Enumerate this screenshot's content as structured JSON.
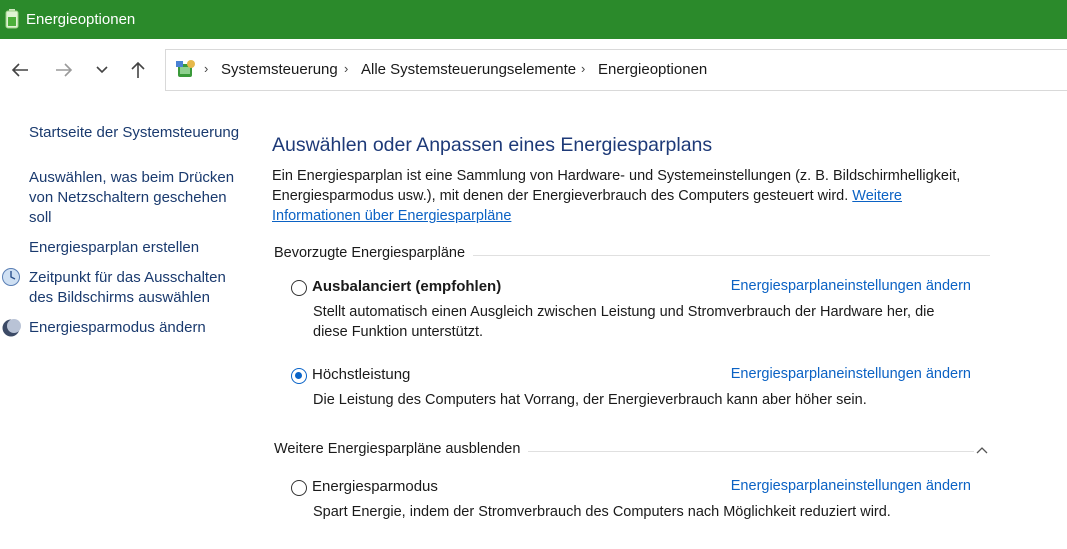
{
  "window": {
    "title": "Energieoptionen",
    "titlebar_color": "#2b8a2b"
  },
  "nav": {
    "back_icon": "arrow-left-icon",
    "forward_icon": "arrow-right-icon",
    "recent_icon": "chevron-down-icon",
    "up_icon": "arrow-up-icon"
  },
  "address": {
    "breadcrumbs": [
      "Systemsteuerung",
      "Alle Systemsteuerungselemente",
      "Energieoptionen"
    ],
    "separator": "›"
  },
  "sidebar": {
    "items": [
      {
        "label": "Startseite der Systemsteuerung",
        "icon": ""
      },
      {
        "label": "Auswählen, was beim Drücken von Netzschaltern geschehen soll",
        "icon": ""
      },
      {
        "label": "Energiesparplan erstellen",
        "icon": ""
      },
      {
        "label": "Zeitpunkt für das Ausschalten des Bildschirms auswählen",
        "icon": "monitor-icon"
      },
      {
        "label": "Energiesparmodus ändern",
        "icon": "moon-icon"
      }
    ]
  },
  "main": {
    "heading": "Auswählen oder Anpassen eines Energiesparplans",
    "intro_text": "Ein Energiesparplan ist eine Sammlung von Hardware- und Systemeinstellungen (z. B. Bildschirmhelligkeit, Energiesparmodus usw.), mit denen der Energieverbrauch des Computers gesteuert wird.",
    "intro_link": "Weitere Informationen über Energiesparpläne",
    "preferred_group_label": "Bevorzugte Energiesparpläne",
    "more_group_label": "Weitere Energiesparpläne ausblenden",
    "plans": [
      {
        "name": "Ausbalanciert (empfohlen)",
        "selected": false,
        "bold": true,
        "link": "Energiesparplaneinstellungen ändern",
        "description": "Stellt automatisch einen Ausgleich zwischen Leistung und Stromverbrauch der Hardware her, die diese Funktion unterstützt."
      },
      {
        "name": "Höchstleistung",
        "selected": true,
        "bold": false,
        "link": "Energiesparplaneinstellungen ändern",
        "description": "Die Leistung des Computers hat Vorrang, der Energieverbrauch kann aber höher sein."
      },
      {
        "name": "Energiesparmodus",
        "selected": false,
        "bold": false,
        "link": "Energiesparplaneinstellungen ändern",
        "description": "Spart Energie, indem der Stromverbrauch des Computers nach Möglichkeit reduziert wird."
      }
    ],
    "link_color": "#0b62c4",
    "heading_color": "#1e3a78",
    "radio_accent": "#0a64c8"
  }
}
